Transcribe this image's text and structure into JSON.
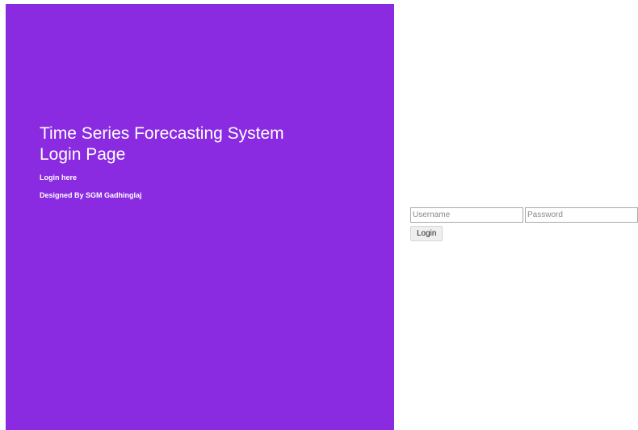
{
  "sidebar": {
    "title_line1": "Time Series Forecasting System",
    "title_line2": "Login Page",
    "login_here": "Login here",
    "designed_by": "Designed By SGM Gadhinglaj",
    "background_color": "#8a2be2"
  },
  "login_form": {
    "username_placeholder": "Username",
    "password_placeholder": "Password",
    "login_button_label": "Login"
  }
}
